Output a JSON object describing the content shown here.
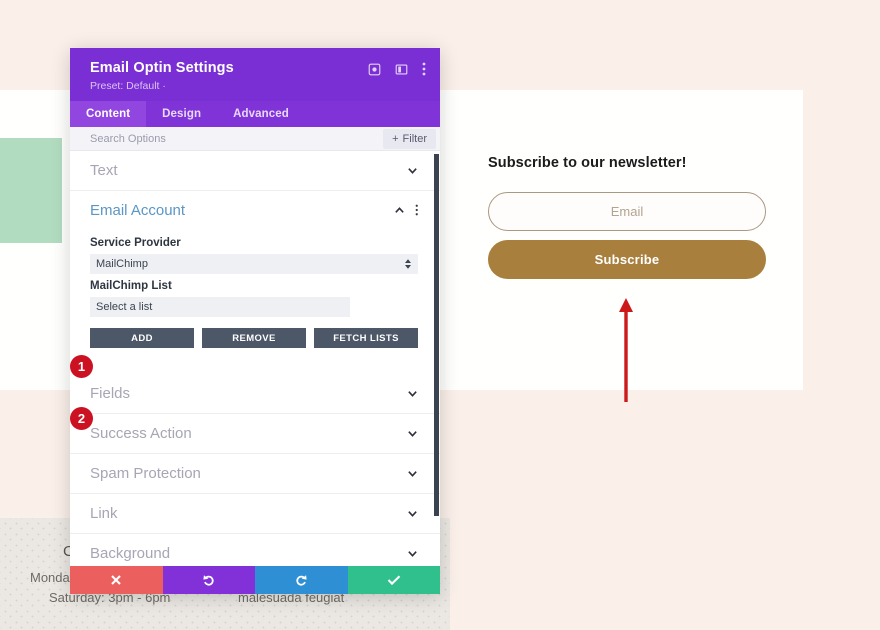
{
  "page": {
    "background_color": "#faefe9",
    "content_band_color": "#fffffd",
    "accent_green": "#b2dcc0"
  },
  "background_site": {
    "texts": {
      "c_fragment": "C",
      "monday": "Monday -",
      "saturday": "Saturday: 3pm - 6pm",
      "malesuada": "malesuada feugiat"
    }
  },
  "optin_preview": {
    "title": "Subscribe to our newsletter!",
    "email_placeholder": "Email",
    "button_label": "Subscribe",
    "button_color": "#a97f3e",
    "annotation_arrow_color": "#cc1a1a"
  },
  "modal": {
    "title": "Email Optin Settings",
    "preset": "Preset: Default ·",
    "header_icons": [
      "target-icon",
      "layout-panel-icon",
      "more-vertical-icon"
    ],
    "tabs": [
      {
        "label": "Content",
        "active": true
      },
      {
        "label": "Design",
        "active": false
      },
      {
        "label": "Advanced",
        "active": false
      }
    ],
    "search": {
      "placeholder": "Search Options",
      "filter_label": "Filter"
    },
    "sections": [
      {
        "label": "Text",
        "state": "collapsed"
      },
      {
        "label": "Email Account",
        "state": "expanded"
      },
      {
        "label": "Fields",
        "state": "collapsed"
      },
      {
        "label": "Success Action",
        "state": "collapsed"
      },
      {
        "label": "Spam Protection",
        "state": "collapsed"
      },
      {
        "label": "Link",
        "state": "collapsed"
      },
      {
        "label": "Background",
        "state": "collapsed"
      }
    ],
    "email_account": {
      "service_provider_label": "Service Provider",
      "service_provider_value": "MailChimp",
      "list_label": "MailChimp List",
      "list_value": "Select a list",
      "buttons": [
        "ADD",
        "REMOVE",
        "FETCH LISTS"
      ]
    },
    "annotations": {
      "badge_one": "1",
      "badge_two": "2"
    },
    "action_bar": [
      {
        "name": "cancel",
        "icon": "close-icon",
        "color": "#ec5f5f"
      },
      {
        "name": "undo",
        "icon": "undo-icon",
        "color": "#8230d8"
      },
      {
        "name": "redo",
        "icon": "redo-icon",
        "color": "#2e8fd4"
      },
      {
        "name": "save",
        "icon": "check-icon",
        "color": "#2fc08e"
      }
    ]
  }
}
